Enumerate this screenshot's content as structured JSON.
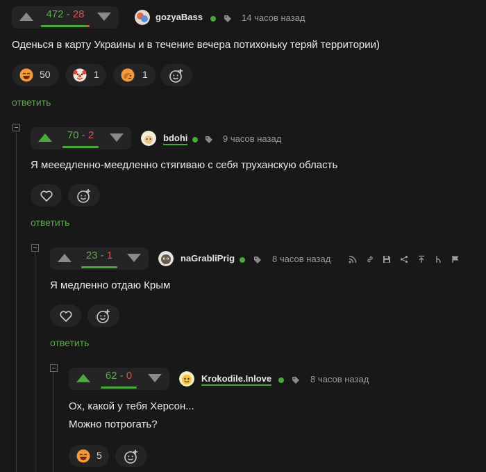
{
  "comments": [
    {
      "rating_plus": "472",
      "rating_minus": "28",
      "rating_ratio": 0.944,
      "username": "gozyaBass",
      "time": "14 часов назад",
      "text": [
        "Оденься в карту Украины и в течение вечера потихоньку теряй территории)"
      ],
      "reactions": [
        {
          "icon": "laughing-face-icon",
          "count": "50"
        },
        {
          "icon": "clown-face-icon",
          "count": "1"
        },
        {
          "icon": "facepalm-face-icon",
          "count": "1"
        }
      ],
      "reply": "ответить"
    },
    {
      "rating_plus": "70",
      "rating_minus": "2",
      "rating_ratio": 0.972,
      "username": "bdohi",
      "time": "9 часов назад",
      "text": [
        "Я мееедленно-меедленно стягиваю с себя труханскую область"
      ],
      "reply": "ответить"
    },
    {
      "rating_plus": "23",
      "rating_minus": "1",
      "rating_ratio": 0.958,
      "username": "naGrabliPrig",
      "time": "8 часов назад",
      "text": [
        "Я медленно отдаю Крым"
      ],
      "reply": "ответить"
    },
    {
      "rating_plus": "62",
      "rating_minus": "0",
      "rating_ratio": 1.0,
      "username": "Krokodile.Inlove",
      "time": "8 часов назад",
      "text": [
        "Ох, какой у тебя Херсон...",
        "Можно потрогать?"
      ],
      "reactions": [
        {
          "icon": "laughing-face-icon",
          "count": "5"
        }
      ]
    }
  ],
  "colors": {
    "background": "#181818",
    "pill": "#242424",
    "accent_green": "#4aa83c",
    "link_green": "#5ca84e",
    "minus_red": "#d9534f",
    "muted": "#9a9a9a"
  }
}
